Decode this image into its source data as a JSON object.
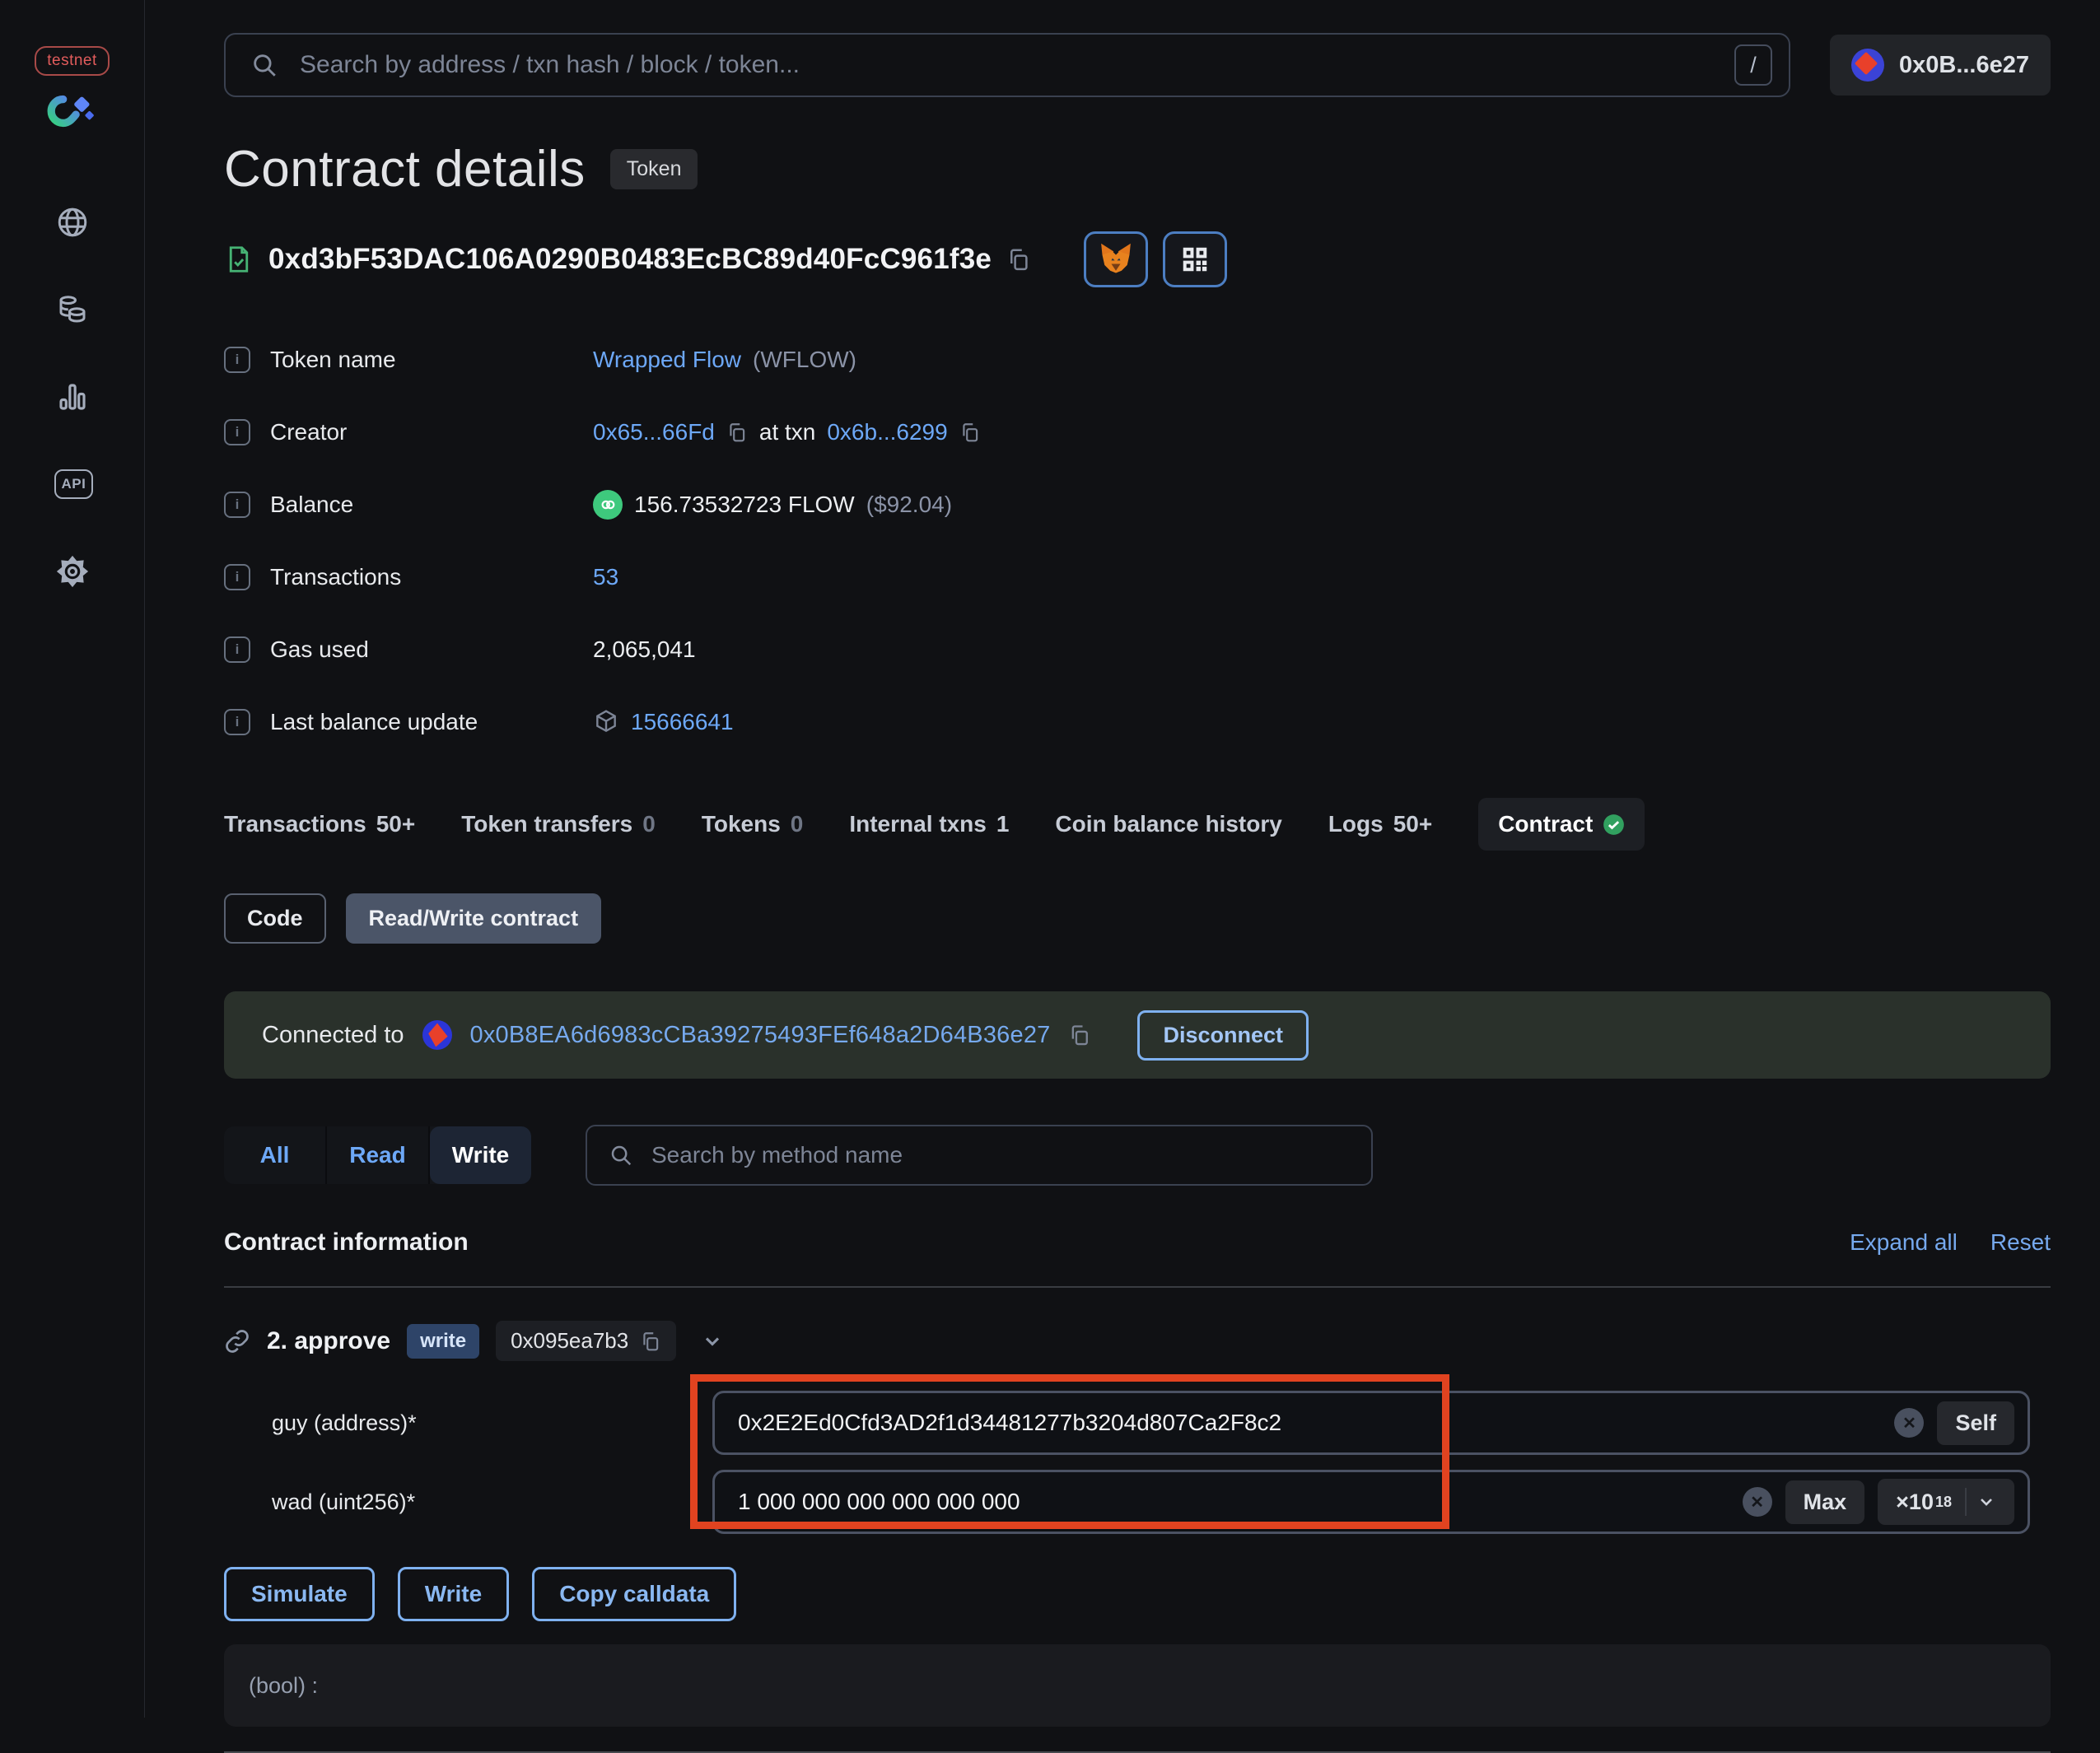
{
  "colors": {
    "accent_blue": "#76a9ee",
    "link_blue": "#6da8f7",
    "annotation_red": "#e14320",
    "success_green": "#31a05f",
    "banner_green": "#2a312b"
  },
  "sidebar": {
    "network_badge": "testnet"
  },
  "topbar": {
    "search_placeholder": "Search by address / txn hash / block / token...",
    "shortcut_key": "/",
    "wallet_label": "0x0B...6e27"
  },
  "header": {
    "title": "Contract details",
    "type_badge": "Token",
    "contract_address": "0xd3bF53DAC106A0290B0483EcBC89d40FcC961f3e"
  },
  "info": {
    "token_name": {
      "label": "Token name",
      "link": "Wrapped Flow",
      "symbol": "(WFLOW)"
    },
    "creator": {
      "label": "Creator",
      "address": "0x65...66Fd",
      "infix": "at txn",
      "txn": "0x6b...6299"
    },
    "balance": {
      "label": "Balance",
      "amount": "156.73532723 FLOW",
      "usd": "($92.04)"
    },
    "transactions": {
      "label": "Transactions",
      "value": "53"
    },
    "gas_used": {
      "label": "Gas used",
      "value": "2,065,041"
    },
    "last_balance_update": {
      "label": "Last balance update",
      "block": "15666641"
    }
  },
  "tabs": [
    {
      "label": "Transactions",
      "count": "50+"
    },
    {
      "label": "Token transfers",
      "count": "0"
    },
    {
      "label": "Tokens",
      "count": "0"
    },
    {
      "label": "Internal txns",
      "count": "1"
    },
    {
      "label": "Coin balance history",
      "count": ""
    },
    {
      "label": "Logs",
      "count": "50+"
    },
    {
      "label": "Contract",
      "count": ""
    }
  ],
  "contract_subtabs": {
    "code": "Code",
    "read_write": "Read/Write contract"
  },
  "connection": {
    "prefix": "Connected to",
    "address": "0x0B8EA6d6983cCBa39275493FEf648a2D64B36e27",
    "disconnect_label": "Disconnect"
  },
  "method_filter": {
    "all": "All",
    "read": "Read",
    "write": "Write",
    "selected": "Write",
    "search_placeholder": "Search by method name"
  },
  "section": {
    "title": "Contract information",
    "expand_all": "Expand all",
    "reset": "Reset"
  },
  "method": {
    "name": "2. approve",
    "badge": "write",
    "selector": "0x095ea7b3",
    "fields": [
      {
        "label": "guy (address)*",
        "value": "0x2E2Ed0Cfd3AD2f1d34481277b3204d807Ca2F8c2",
        "action": "Self"
      },
      {
        "label": "wad (uint256)*",
        "value": "1 000 000 000 000 000 000",
        "action": "Max",
        "multiplier_base": "×10",
        "multiplier_exp": "18"
      }
    ],
    "actions": {
      "simulate": "Simulate",
      "write": "Write",
      "copy_calldata": "Copy calldata"
    },
    "output": "(bool) :"
  }
}
